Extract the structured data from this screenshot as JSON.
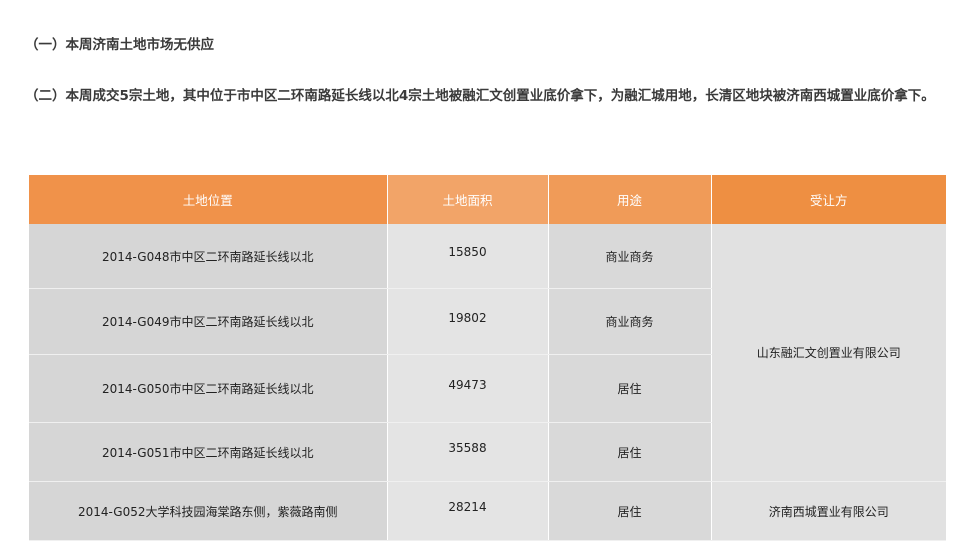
{
  "paragraphs": {
    "p1": "（一）本周济南土地市场无供应",
    "p2": "（二）本周成交5宗土地，其中位于市中区二环南路延长线以北4宗土地被融汇文创置业底价拿下，为融汇城用地，长清区地块被济南西城置业底价拿下。"
  },
  "table": {
    "headers": [
      "土地位置",
      "土地面积",
      "用途",
      "受让方"
    ],
    "rows": [
      {
        "location": "2014-G048市中区二环南路延长线以北",
        "area": "15850",
        "use": "商业商务"
      },
      {
        "location": "2014-G049市中区二环南路延长线以北",
        "area": "19802",
        "use": "商业商务"
      },
      {
        "location": "2014-G050市中区二环南路延长线以北",
        "area": "49473",
        "use": "居住"
      },
      {
        "location": "2014-G051市中区二环南路延长线以北",
        "area": "35588",
        "use": "居住"
      },
      {
        "location": "2014-G052大学科技园海棠路东侧，紫薇路南侧",
        "area": "28214",
        "use": "居住"
      }
    ],
    "buyers": {
      "group_1": "山东融汇文创置业有限公司",
      "group_2": "济南西城置业有限公司"
    }
  },
  "colors": {
    "header_orange": "#f0924a",
    "header_light_orange": "#f2a468",
    "cell_gray": "#d6d6d6",
    "cell_light_gray": "#e4e4e4"
  }
}
